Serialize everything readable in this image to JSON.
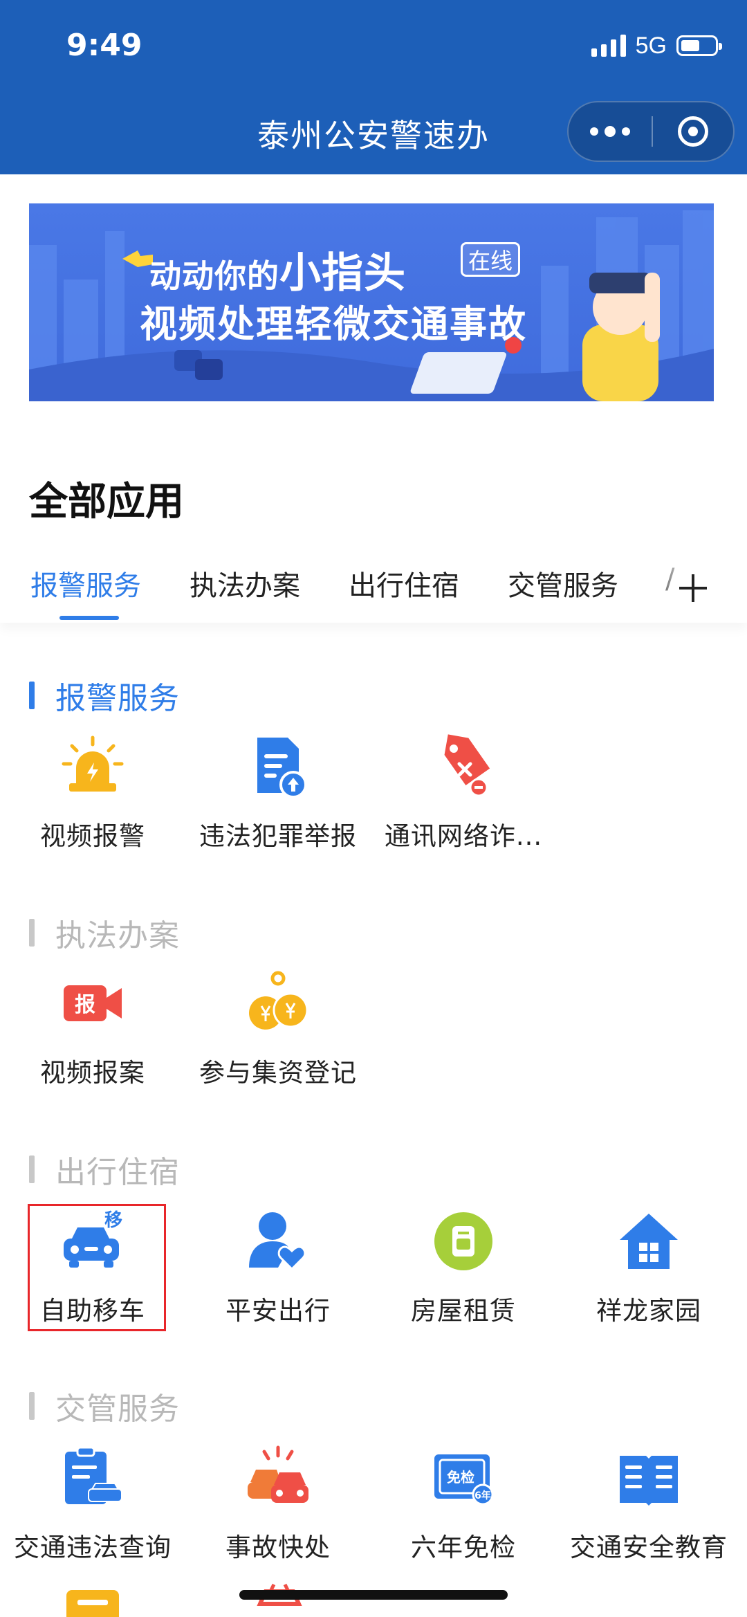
{
  "status": {
    "time": "9:49",
    "network": "5G"
  },
  "header": {
    "title": "泰州公安警速办",
    "more_icon": "more-dots-icon",
    "close_icon": "target-close-icon"
  },
  "banner": {
    "line1_prefix": "动动你的",
    "line1_big": "小指头",
    "badge": "在线",
    "line2": "视频处理轻微交通事故",
    "colors": {
      "background": "#4a78e6",
      "accent": "#ffd43a"
    }
  },
  "page": {
    "all_apps_title": "全部应用"
  },
  "tabs": [
    {
      "label": "报警服务",
      "active": true
    },
    {
      "label": "执法办案",
      "active": false
    },
    {
      "label": "出行住宿",
      "active": false
    },
    {
      "label": "交管服务",
      "active": false
    },
    {
      "label": "/",
      "active": false
    }
  ],
  "sections": [
    {
      "title": "报警服务",
      "items": [
        {
          "label": "视频报警",
          "icon": "siren-icon"
        },
        {
          "label": "违法犯罪举报",
          "icon": "report-upload-icon"
        },
        {
          "label": "通讯网络诈...",
          "icon": "fraud-tag-icon"
        }
      ]
    },
    {
      "title": "执法办案",
      "items": [
        {
          "label": "视频报案",
          "icon": "video-report-icon"
        },
        {
          "label": "参与集资登记",
          "icon": "money-bags-icon"
        }
      ]
    },
    {
      "title": "出行住宿",
      "items": [
        {
          "label": "自助移车",
          "icon": "move-car-icon"
        },
        {
          "label": "平安出行",
          "icon": "user-heart-icon"
        },
        {
          "label": "房屋租赁",
          "icon": "rental-icon"
        },
        {
          "label": "祥龙家园",
          "icon": "home-icon"
        }
      ]
    },
    {
      "title": "交管服务",
      "items": [
        {
          "label": "交通违法查询",
          "icon": "violation-query-icon"
        },
        {
          "label": "事故快处",
          "icon": "accident-icon"
        },
        {
          "label": "六年免检",
          "icon": "inspection-exempt-icon"
        },
        {
          "label": "交通安全教育",
          "icon": "education-book-icon"
        }
      ]
    }
  ],
  "icon_text": {
    "move": "移",
    "report": "报",
    "exempt": "免检",
    "six_years": "6年"
  },
  "colors": {
    "primary": "#1d5fb8",
    "accent_blue": "#2f7de8",
    "highlight_red": "#e8262a"
  }
}
